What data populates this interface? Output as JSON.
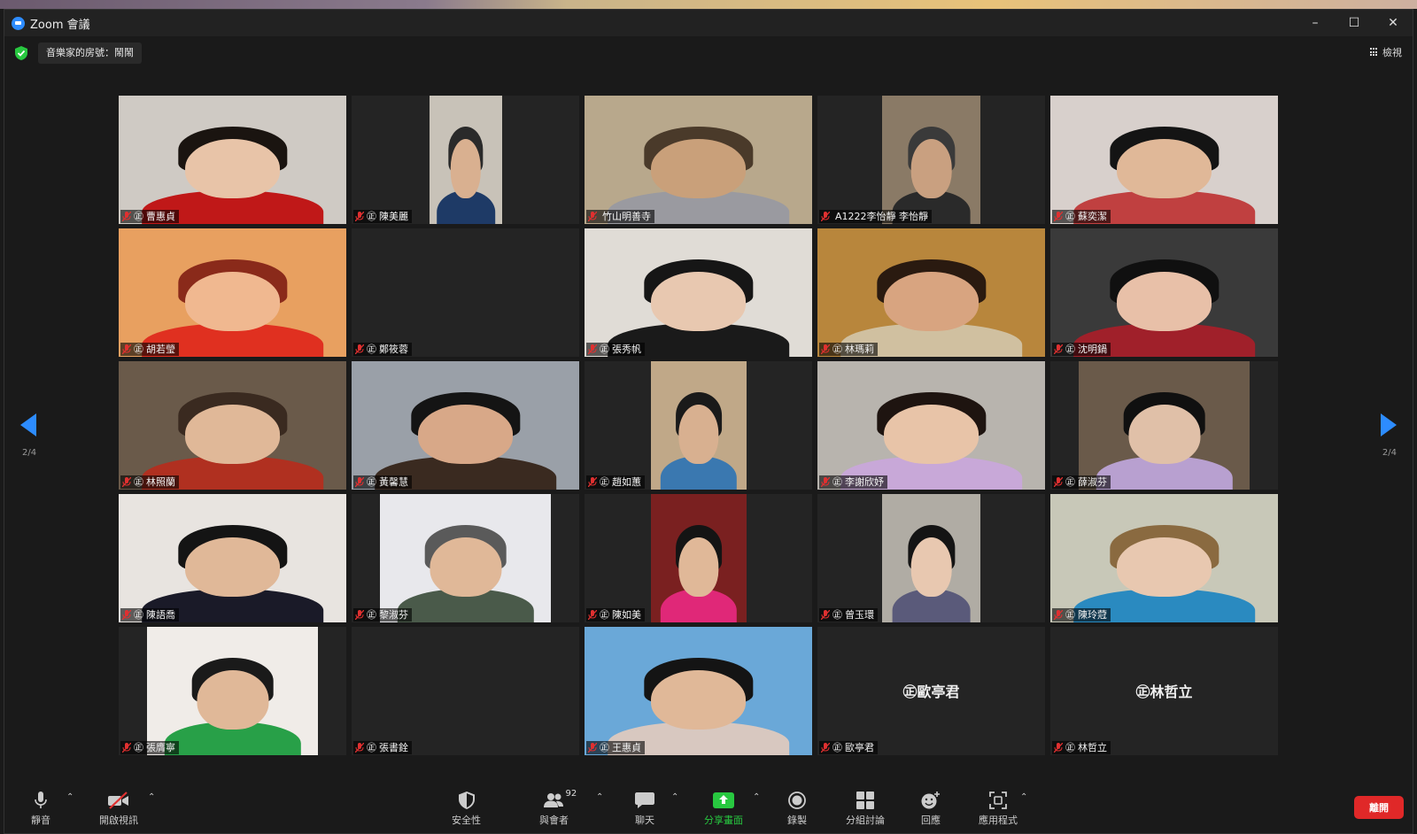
{
  "window": {
    "title": "Zoom 會議"
  },
  "topbar": {
    "meeting_info": "音樂家的房號：鬧鬧",
    "view_label": "檢視"
  },
  "pager": {
    "left_indicator": "2/4",
    "right_indicator": "2/4"
  },
  "participants": [
    {
      "name": "曹惠貞",
      "badge": "㊣",
      "video": true,
      "bg": "#cfcac4",
      "skin": "#e8c4a8",
      "hair": "#1a1410",
      "shirt": "#c01818",
      "vw": 1
    },
    {
      "name": "陳美麗",
      "badge": "㊣",
      "video": true,
      "bg": "#c8c2b8",
      "skin": "#d9b090",
      "hair": "#2a2a2a",
      "shirt": "#1e3a66",
      "vw": 0.32
    },
    {
      "name": "竹山明善寺",
      "badge": "",
      "video": true,
      "bg": "#b8a88c",
      "skin": "#c9a07a",
      "hair": "#4a3a2a",
      "shirt": "#9a9aa0",
      "vw": 1
    },
    {
      "name": "A1222李怡靜 李怡靜",
      "badge": "",
      "video": true,
      "bg": "#8a7a66",
      "skin": "#c9a080",
      "hair": "#3a3a3a",
      "shirt": "#2a2a2a",
      "vw": 0.43
    },
    {
      "name": "蘇奕潔",
      "badge": "㊣",
      "video": true,
      "bg": "#d8d0cc",
      "skin": "#e0b898",
      "hair": "#141414",
      "shirt": "#c04040",
      "vw": 1
    },
    {
      "name": "胡若瑩",
      "badge": "㊣",
      "video": true,
      "bg": "#e8a060",
      "skin": "#f0b890",
      "hair": "#8a2a1a",
      "shirt": "#e03020",
      "vw": 1
    },
    {
      "name": "鄭筱蓉",
      "badge": "㊣",
      "video": false,
      "bg": "#242424"
    },
    {
      "name": "張秀帆",
      "badge": "㊣",
      "video": true,
      "bg": "#e0dcd6",
      "skin": "#e8c8b0",
      "hair": "#161616",
      "shirt": "#1a1a1a",
      "vw": 1
    },
    {
      "name": "林瑪莉",
      "badge": "㊣",
      "video": true,
      "bg": "#b8863c",
      "skin": "#d8a480",
      "hair": "#2a1a10",
      "shirt": "#d0c0a0",
      "vw": 1
    },
    {
      "name": "沈明鍋",
      "badge": "㊣",
      "video": true,
      "bg": "#3a3a3a",
      "skin": "#e8c0a8",
      "hair": "#101010",
      "shirt": "#a0202a",
      "vw": 1
    },
    {
      "name": "林照蘭",
      "badge": "㊣",
      "video": true,
      "bg": "#6a5a4a",
      "skin": "#e0b898",
      "hair": "#3a2a20",
      "shirt": "#b03020",
      "vw": 1
    },
    {
      "name": "黃馨慧",
      "badge": "㊣",
      "video": true,
      "bg": "#9aa0a8",
      "skin": "#d8a888",
      "hair": "#141414",
      "shirt": "#3a2a20",
      "vw": 1
    },
    {
      "name": "趙如蕙",
      "badge": "㊣",
      "video": true,
      "bg": "#c0a888",
      "skin": "#d8b090",
      "hair": "#1a1a1a",
      "shirt": "#3a78b0",
      "vw": 0.42
    },
    {
      "name": "李謝欣妤",
      "badge": "㊣",
      "video": true,
      "bg": "#b8b4ae",
      "skin": "#e8c4a8",
      "hair": "#1e1410",
      "shirt": "#c8a8d8",
      "vw": 1
    },
    {
      "name": "薛淑芬",
      "badge": "㊣",
      "video": true,
      "bg": "#6a5a4a",
      "skin": "#e0c0a8",
      "hair": "#101010",
      "shirt": "#b8a0d0",
      "vw": 0.75
    },
    {
      "name": "陳語喬",
      "badge": "㊣",
      "video": true,
      "bg": "#e8e4e0",
      "skin": "#e0b898",
      "hair": "#141414",
      "shirt": "#1a1a28",
      "vw": 1
    },
    {
      "name": "黎淑芬",
      "badge": "㊣",
      "video": true,
      "bg": "#e8e8ec",
      "skin": "#e0b898",
      "hair": "#5a5a5a",
      "shirt": "#4a5a4a",
      "vw": 0.75
    },
    {
      "name": "陳如美",
      "badge": "㊣",
      "video": true,
      "bg": "#7a2020",
      "skin": "#e0b898",
      "hair": "#141414",
      "shirt": "#e02878",
      "vw": 0.42
    },
    {
      "name": "曾玉環",
      "badge": "㊣",
      "video": true,
      "bg": "#b0aca4",
      "skin": "#e8c8b0",
      "hair": "#141414",
      "shirt": "#5a5a7a",
      "vw": 0.43
    },
    {
      "name": "陳玲蒄",
      "badge": "㊣",
      "video": true,
      "bg": "#c8c8b8",
      "skin": "#e8c8b0",
      "hair": "#8a6a40",
      "shirt": "#2a8ac0",
      "vw": 1
    },
    {
      "name": "張膺寧",
      "badge": "㊣",
      "video": true,
      "bg": "#f0ece8",
      "skin": "#e0b898",
      "hair": "#1a1a1a",
      "shirt": "#28a048",
      "vw": 0.75
    },
    {
      "name": "張書銓",
      "badge": "㊣",
      "video": false,
      "bg": "#242424"
    },
    {
      "name": "王惠貞",
      "badge": "㊣",
      "video": true,
      "bg": "#6aa8d8",
      "skin": "#e0b898",
      "hair": "#141414",
      "shirt": "#d8c8c0",
      "vw": 1
    },
    {
      "name": "歐亭君",
      "badge": "㊣",
      "video": false,
      "bg": "#242424",
      "center": "㊣歐亭君"
    },
    {
      "name": "林哲立",
      "badge": "㊣",
      "video": false,
      "bg": "#242424",
      "center": "㊣林哲立"
    }
  ],
  "toolbar": {
    "mute": "靜音",
    "start_video": "開啟視訊",
    "security": "安全性",
    "participants": "與會者",
    "participants_count": "92",
    "chat": "聊天",
    "share": "分享畫面",
    "record": "錄製",
    "breakout": "分組討論",
    "reactions": "回應",
    "apps": "應用程式",
    "leave": "離開"
  },
  "colors": {
    "accent": "#2d8cff",
    "share_green": "#28c840",
    "leave_red": "#e02828",
    "mute_red": "#e03030"
  }
}
